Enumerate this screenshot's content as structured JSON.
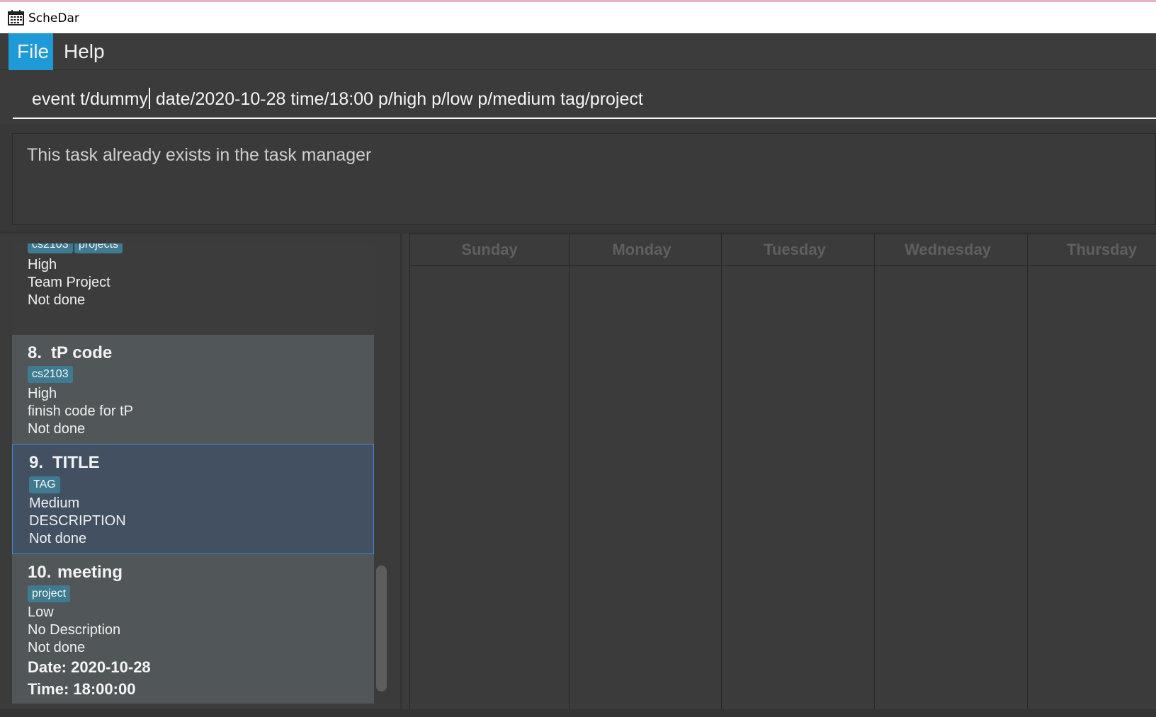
{
  "window": {
    "title": "ScheDar",
    "icon": "calendar-icon"
  },
  "menu": {
    "file": "File",
    "help": "Help"
  },
  "command": {
    "before_caret": "event t/dummy",
    "after_caret": " date/2020-10-28 time/18:00 p/high p/low p/medium tag/project"
  },
  "result": {
    "message": "This task already exists in the task manager"
  },
  "tasks": {
    "partial": {
      "tags": [
        "cs2103",
        "projects"
      ],
      "priority": "High",
      "description": "Team Project",
      "status": "Not done"
    },
    "items": [
      {
        "index": "8.",
        "title": "tP code",
        "tags": [
          "cs2103"
        ],
        "priority": "High",
        "description": "finish code for tP",
        "status": "Not done"
      },
      {
        "index": "9.",
        "title": "TITLE",
        "tags": [
          "TAG"
        ],
        "priority": "Medium",
        "description": "DESCRIPTION",
        "status": "Not done",
        "selected": true
      },
      {
        "index": "10.",
        "title": "meeting",
        "tags": [
          "project"
        ],
        "priority": "Low",
        "description": "No Description",
        "status": "Not done",
        "date": "Date: 2020-10-28",
        "time": "Time: 18:00:00"
      }
    ]
  },
  "calendar": {
    "days": [
      "Sunday",
      "Monday",
      "Tuesday",
      "Wednesday",
      "Thursday"
    ]
  },
  "colors": {
    "accent": "#1e9ad6",
    "tag": "#3e7b91",
    "selected_card": "#435062",
    "card": "#515658",
    "background": "#3b3b3b"
  }
}
